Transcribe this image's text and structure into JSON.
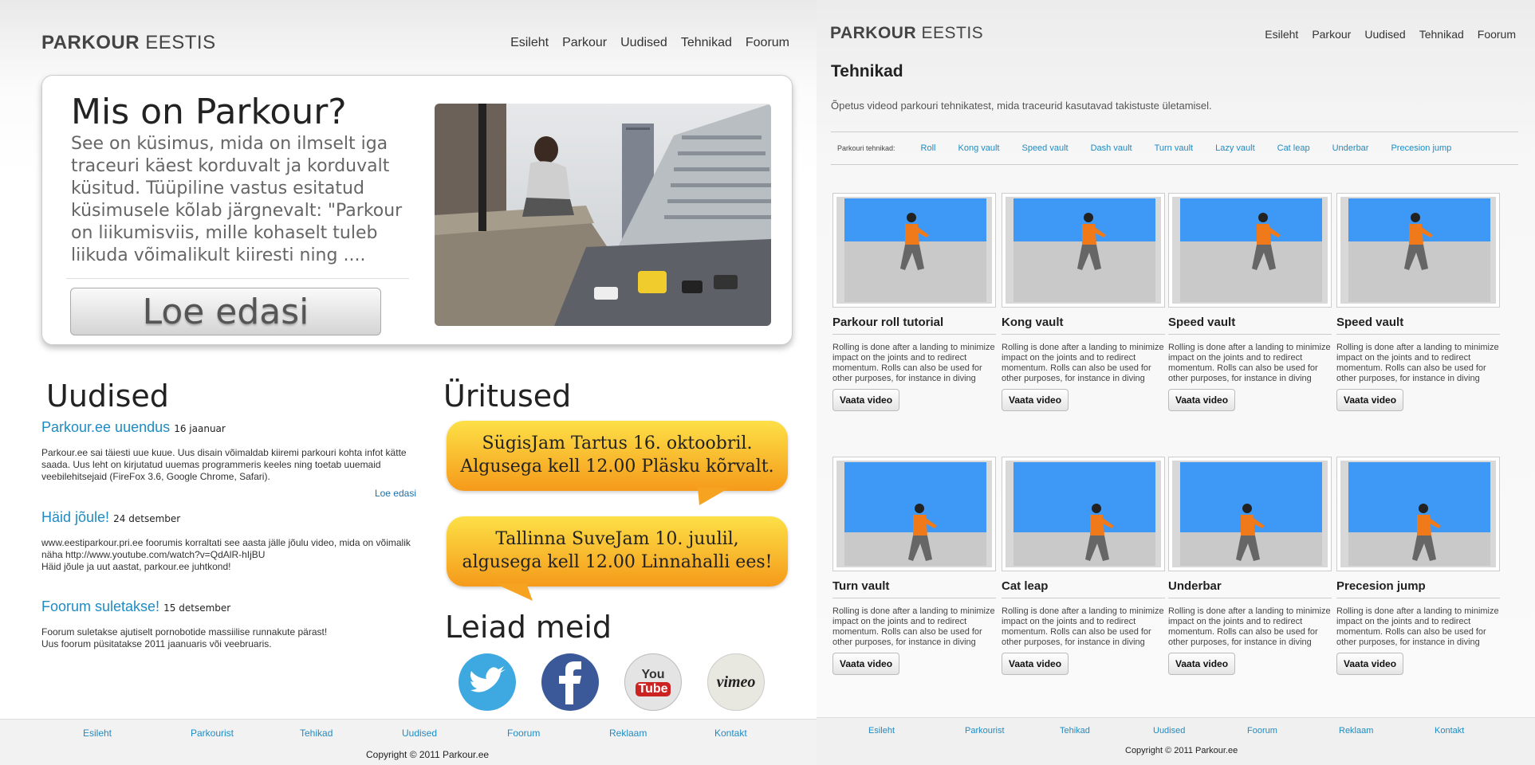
{
  "left": {
    "logo": {
      "bold": "PARKOUR",
      "light": "EESTIS"
    },
    "nav": [
      "Esileht",
      "Parkour",
      "Uudised",
      "Tehnikad",
      "Foorum"
    ],
    "hero": {
      "title": "Mis on Parkour?",
      "text": "See on küsimus, mida on ilmselt iga traceuri käest korduvalt ja korduvalt küsitud. Tüüpiline vastus esitatud küsimusele kõlab järgnevalt: \"Parkour on liikumisviis, mille kohaselt tuleb liikuda võimalikult kiiresti ning ....",
      "button": "Loe edasi"
    },
    "news": {
      "heading": "Uudised",
      "items": [
        {
          "title": "Parkour.ee uuendus",
          "date": "16 jaanuar",
          "body": "Parkour.ee sai täiesti  uue kuue. Uus disain võimaldab kiiremi parkouri kohta infot kätte saada. Uus leht on kirjutatud uuemas programmeris keeles ning toetab uuemaid veebilehitsejaid (FireFox 3.6, Google Chrome, Safari).",
          "link": "Loe edasi"
        },
        {
          "title": "Häid jõule!",
          "date": "24 detsember",
          "body": "www.eestiparkour.pri.ee foorumis korraltati see aasta jälle jõulu video, mida on võimalik näha http://www.youtube.com/watch?v=QdAlR-hIjBU\nHäid jõule ja uut aastat, parkour.ee juhtkond!"
        },
        {
          "title": "Foorum suletakse!",
          "date": "15 detsember",
          "body": "Foorum suletakse ajutiselt pornobotide massiilise runnakute pärast!\nUus foorum püsitatakse 2011 jaanuaris või veebruaris."
        }
      ]
    },
    "events": {
      "heading": "Üritused",
      "items": [
        "SügisJam Tartus 16. oktoobril.\nAlgusega kell 12.00 Pläsku kõrvalt.",
        "Tallinna SuveJam  10. juulil,\nalgusega kell 12.00 Linnahalli ees!"
      ]
    },
    "find": {
      "heading": "Leiad meid",
      "icons": [
        {
          "name": "twitter-icon",
          "color": "#3ea9e0"
        },
        {
          "name": "facebook-icon",
          "color": "#3b5998"
        },
        {
          "name": "youtube-icon",
          "color": "#cc2222",
          "label_top": "You",
          "label_bottom": "Tube"
        },
        {
          "name": "vimeo-icon",
          "color": "#e8e8e0",
          "label": "vimeo"
        }
      ]
    },
    "footer": {
      "links": [
        "Esileht",
        "Parkourist",
        "Tehikad",
        "Uudised",
        "Foorum",
        "Reklaam",
        "Kontakt"
      ],
      "copyright": "Copyright © 2011 Parkour.ee"
    }
  },
  "right": {
    "logo": {
      "bold": "PARKOUR",
      "light": "EESTIS"
    },
    "nav": [
      "Esileht",
      "Parkour",
      "Uudised",
      "Tehnikad",
      "Foorum"
    ],
    "title": "Tehnikad",
    "subtitle": "Õpetus videod parkouri tehnikatest, mida traceurid kasutavad takistuste ületamisel.",
    "tabs_label": "Parkouri tehnikad:",
    "tabs": [
      "Roll",
      "Kong vault",
      "Speed vault",
      "Dash vault",
      "Turn vault",
      "Lazy vault",
      "Cat leap",
      "Underbar",
      "Precesion jump"
    ],
    "cards": [
      {
        "title": "Parkour roll tutorial",
        "desc": "Rolling is done after a landing to minimize impact on the joints and to redirect momentum. Rolls can also be used for other purposes, for instance in diving through a railing where it is no",
        "button": "Vaata video"
      },
      {
        "title": "Kong vault",
        "desc": "Rolling is done after a landing to minimize impact on the joints and to redirect momentum. Rolls can also be used for other purposes, for instance in diving through a railing where it is no",
        "button": "Vaata video"
      },
      {
        "title": "Speed vault",
        "desc": "Rolling is done after a landing to minimize impact on the joints and to redirect momentum. Rolls can also be used for other purposes, for instance in diving through a railing where it is no",
        "button": "Vaata video"
      },
      {
        "title": "Speed vault",
        "desc": "Rolling is done after a landing to minimize impact on the joints and to redirect momentum. Rolls can also be used for other purposes, for instance in diving through a railing where it is no",
        "button": "Vaata video"
      },
      {
        "title": "Turn vault",
        "desc": "Rolling is done after a landing to minimize impact on the joints and to redirect momentum. Rolls can also be used for other purposes, for instance in diving through a railing where it is no",
        "button": "Vaata video"
      },
      {
        "title": "Cat leap",
        "desc": "Rolling is done after a landing to minimize impact on the joints and to redirect momentum. Rolls can also be used for other purposes, for instance in diving through a railing where it is no",
        "button": "Vaata video"
      },
      {
        "title": "Underbar",
        "desc": "Rolling is done after a landing to minimize impact on the joints and to redirect momentum. Rolls can also be used for other purposes, for instance in diving through a railing where it is no",
        "button": "Vaata video"
      },
      {
        "title": "Precesion jump",
        "desc": "Rolling is done after a landing to minimize impact on the joints and to redirect momentum. Rolls can also be used for other purposes, for instance in diving through a railing where it is no",
        "button": "Vaata video"
      }
    ],
    "footer": {
      "links": [
        "Esileht",
        "Parkourist",
        "Tehikad",
        "Uudised",
        "Foorum",
        "Reklaam",
        "Kontakt"
      ],
      "copyright": "Copyright © 2011 Parkour.ee"
    }
  },
  "colors": {
    "accent": "#1f8bc2",
    "sky": "#3d99f5",
    "runner_shirt": "#f07a1a",
    "bubble_top": "#fde047",
    "bubble_bottom": "#f59a1a"
  }
}
